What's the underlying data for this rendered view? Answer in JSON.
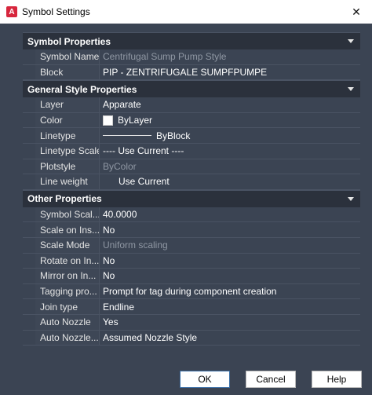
{
  "window": {
    "title": "Symbol Settings",
    "app_icon": "A",
    "close_icon": "✕"
  },
  "sections": [
    {
      "title": "Symbol Properties",
      "rows": [
        {
          "label": "Symbol Name",
          "value": "Centrifugal Sump Pump Style",
          "dim": true
        },
        {
          "label": "Block",
          "value": "PIP - ZENTRIFUGALE SUMPFPUMPE",
          "dim": false
        }
      ]
    },
    {
      "title": "General Style Properties",
      "rows": [
        {
          "label": "Layer",
          "value": "Apparate",
          "dim": false
        },
        {
          "label": "Color",
          "value": "ByLayer",
          "dim": false,
          "swatch": "#ffffff"
        },
        {
          "label": "Linetype",
          "value": "ByBlock",
          "dim": false,
          "line": true
        },
        {
          "label": "Linetype Scale",
          "value": "---- Use Current ----",
          "dim": false
        },
        {
          "label": "Plotstyle",
          "value": "ByColor",
          "dim": true
        },
        {
          "label": "Line weight",
          "value": "Use Current",
          "dim": false,
          "indent": true
        }
      ]
    },
    {
      "title": "Other Properties",
      "rows": [
        {
          "label": "Symbol Scal...",
          "value": "40.0000",
          "dim": false
        },
        {
          "label": "Scale on Ins...",
          "value": "No",
          "dim": false
        },
        {
          "label": "Scale Mode",
          "value": "Uniform scaling",
          "dim": true
        },
        {
          "label": "Rotate on In...",
          "value": "No",
          "dim": false
        },
        {
          "label": "Mirror on In...",
          "value": "No",
          "dim": false
        },
        {
          "label": "Tagging pro...",
          "value": "Prompt for tag during component creation",
          "dim": false
        },
        {
          "label": "Join type",
          "value": "Endline",
          "dim": false
        },
        {
          "label": "Auto Nozzle",
          "value": "Yes",
          "dim": false
        },
        {
          "label": "Auto Nozzle...",
          "value": "Assumed Nozzle Style",
          "dim": false
        }
      ]
    }
  ],
  "buttons": {
    "ok": "OK",
    "cancel": "Cancel",
    "help": "Help"
  }
}
